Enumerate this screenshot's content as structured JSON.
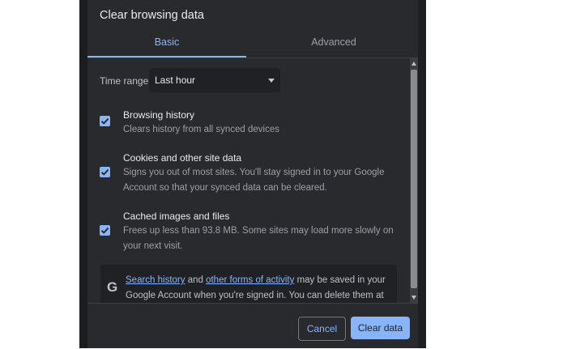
{
  "dialog": {
    "title": "Clear browsing data",
    "tabs": [
      {
        "label": "Basic",
        "selected": true
      },
      {
        "label": "Advanced",
        "selected": false
      }
    ],
    "time_range": {
      "label": "Time range",
      "value": "Last hour"
    },
    "options": [
      {
        "title": "Browsing history",
        "desc": "Clears history from all synced devices",
        "checked": true
      },
      {
        "title": "Cookies and other site data",
        "desc": "Signs you out of most sites. You'll stay signed in to your Google Account so that your synced data can be cleared.",
        "checked": true
      },
      {
        "title": "Cached images and files",
        "desc": "Frees up less than 93.8 MB. Some sites may load more slowly on your next visit.",
        "checked": true
      }
    ],
    "notice": {
      "icon": "google-g-icon",
      "link1": "Search history",
      "text1": " and ",
      "link2": "other forms of activity",
      "text2": " may be saved in your Google Account when you're signed in. You can delete them at any time."
    },
    "buttons": {
      "cancel": "Cancel",
      "clear": "Clear data"
    }
  },
  "colors": {
    "accent": "#8ab4f8",
    "dialog_bg": "#292a2d",
    "text_primary": "#e8eaed",
    "text_secondary": "#9aa0a6"
  }
}
